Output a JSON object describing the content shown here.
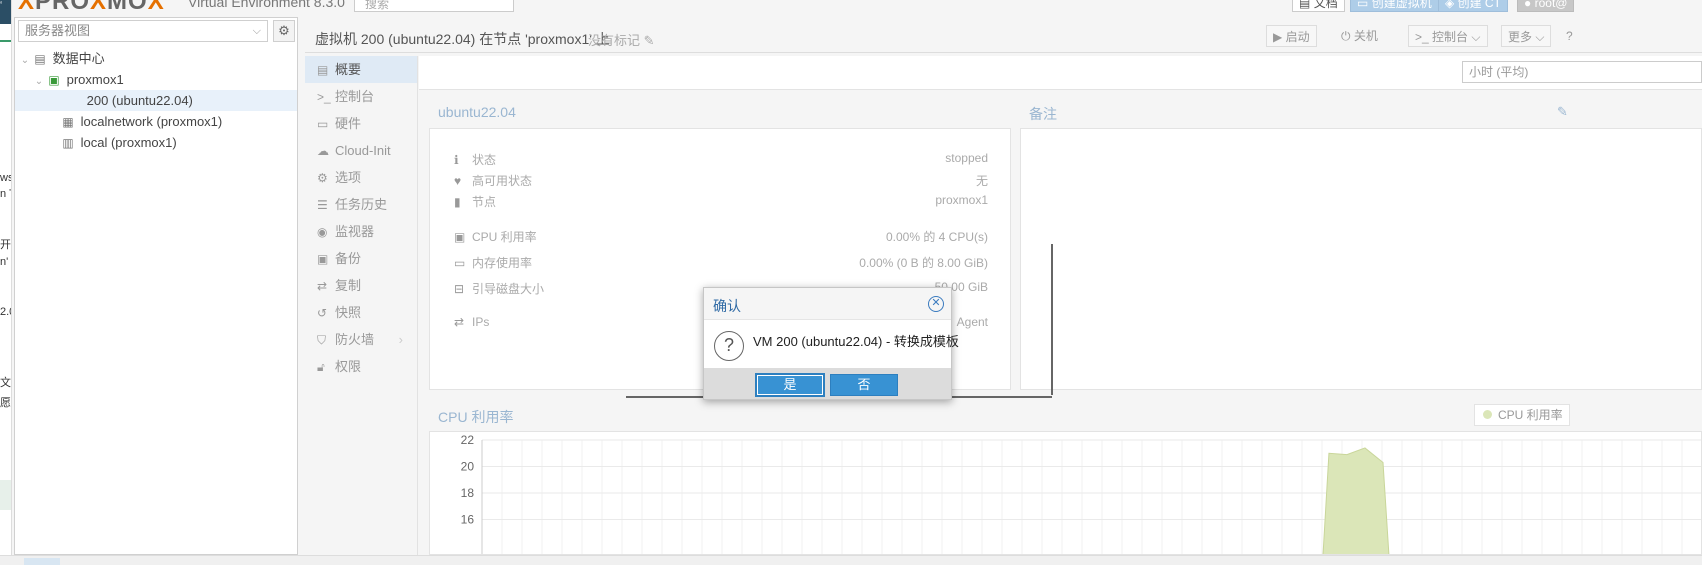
{
  "edge_fragments": [
    "ws",
    "n T",
    "开",
    "n'",
    "2.0",
    "文",
    "愿",
    "‘"
  ],
  "header": {
    "logo_prefix": "PRO",
    "logo_x": "X",
    "logo_mid": "MO",
    "logo_x2": "X",
    "version": "Virtual Environment 8.3.0",
    "search_placeholder": "搜索",
    "docs_label": "文档",
    "create_vm_label": "创建虚拟机",
    "create_ct_label": "创建 CT",
    "user_label": "root@"
  },
  "left_panel": {
    "view_select": "服务器视图",
    "tree": [
      {
        "label": "数据中心",
        "level": 0
      },
      {
        "label": "proxmox1",
        "level": 1
      },
      {
        "label": "200 (ubuntu22.04)",
        "level": 2
      },
      {
        "label": "localnetwork (proxmox1)",
        "level": 2
      },
      {
        "label": "local (proxmox1)",
        "level": 2
      }
    ]
  },
  "vm_bar": {
    "title": "虚拟机 200 (ubuntu22.04) 在节点 'proxmox1' 上",
    "no_tags": "没有标记",
    "start_label": "启动",
    "shutdown_label": "关机",
    "console_label": "控制台",
    "more_label": "更多"
  },
  "subnav": [
    {
      "label": "概要",
      "icon": "book-icon",
      "active": true
    },
    {
      "label": "控制台",
      "icon": "terminal-icon",
      "active": false
    },
    {
      "label": "硬件",
      "icon": "monitor-icon",
      "active": false
    },
    {
      "label": "Cloud-Init",
      "icon": "cloud-icon",
      "active": false
    },
    {
      "label": "选项",
      "icon": "gear-icon",
      "active": false
    },
    {
      "label": "任务历史",
      "icon": "list-icon",
      "active": false
    },
    {
      "label": "监视器",
      "icon": "eye-icon",
      "active": false
    },
    {
      "label": "备份",
      "icon": "floppy-icon",
      "active": false
    },
    {
      "label": "复制",
      "icon": "retweet-icon",
      "active": false
    },
    {
      "label": "快照",
      "icon": "history-icon",
      "active": false
    },
    {
      "label": "防火墙",
      "icon": "shield-icon",
      "active": false
    },
    {
      "label": "权限",
      "icon": "unlock-icon",
      "active": false
    }
  ],
  "timeframe": "小时 (平均)",
  "summary": {
    "title": "ubuntu22.04",
    "rows": [
      {
        "label": "状态",
        "value": "stopped",
        "icon": "info-icon"
      },
      {
        "label": "高可用状态",
        "value": "无",
        "icon": "heartbeat-icon"
      },
      {
        "label": "节点",
        "value": "proxmox1",
        "icon": "building-icon"
      },
      {
        "label": "CPU 利用率",
        "value": "0.00% 的 4 CPU(s)",
        "icon": "cpu-icon"
      },
      {
        "label": "内存使用率",
        "value": "0.00% (0 B 的 8.00 GiB)",
        "icon": "memory-icon"
      },
      {
        "label": "引导磁盘大小",
        "value": "50.00 GiB",
        "icon": "hdd-icon"
      },
      {
        "label": "IPs",
        "value": "Agent",
        "icon": "exchange-icon"
      }
    ]
  },
  "notes": {
    "title": "备注"
  },
  "cpu_chart": {
    "title": "CPU 利用率",
    "legend": "CPU 利用率",
    "color_fill": "#dbe6b8"
  },
  "chart_data": {
    "type": "area",
    "title": "CPU 利用率",
    "yticks": [
      16,
      18,
      20,
      22
    ],
    "ylim": [
      15,
      22
    ],
    "series": [
      {
        "name": "CPU 利用率",
        "values": [
          0,
          0,
          0,
          0,
          0,
          0,
          0,
          0,
          0,
          0,
          0,
          0,
          0,
          0,
          0,
          0,
          0,
          0,
          0,
          0,
          0,
          0,
          0,
          0,
          0,
          0,
          0,
          0,
          0,
          0,
          0,
          0,
          0,
          0,
          0,
          0,
          0,
          0,
          0,
          0,
          0,
          0,
          0,
          0,
          0,
          0,
          0,
          21,
          20.9,
          21.4,
          20.3
        ]
      }
    ]
  },
  "dialog": {
    "title": "确认",
    "message": "VM 200 (ubuntu22.04) - 转换成模板",
    "yes_label": "是",
    "no_label": "否"
  },
  "colors": {
    "accent": "#3892d3",
    "title_blue": "#2f6aa5",
    "panel_title": "#9ab6d1",
    "orange": "#e57000"
  }
}
